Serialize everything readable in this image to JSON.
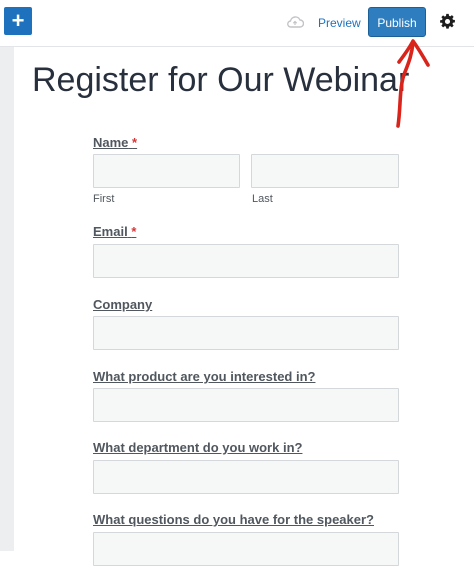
{
  "toolbar": {
    "add_label": "+",
    "preview_label": "Preview",
    "publish_label": "Publish",
    "accent_color": "#1e72bd"
  },
  "page": {
    "title": "Register for Our Webinar"
  },
  "form": {
    "name": {
      "label": "Name",
      "required_mark": "*",
      "first_sublabel": "First",
      "last_sublabel": "Last"
    },
    "email": {
      "label": "Email",
      "required_mark": "*"
    },
    "company": {
      "label": "Company"
    },
    "product": {
      "label": "What product are you interested in?"
    },
    "department": {
      "label": "What department do you work in?"
    },
    "questions": {
      "label": "What questions do you have for the speaker?"
    }
  },
  "icons": {
    "add": "plus-icon",
    "cloud": "cloud-icon",
    "settings": "gear-icon",
    "annotation": "red-arrow"
  }
}
